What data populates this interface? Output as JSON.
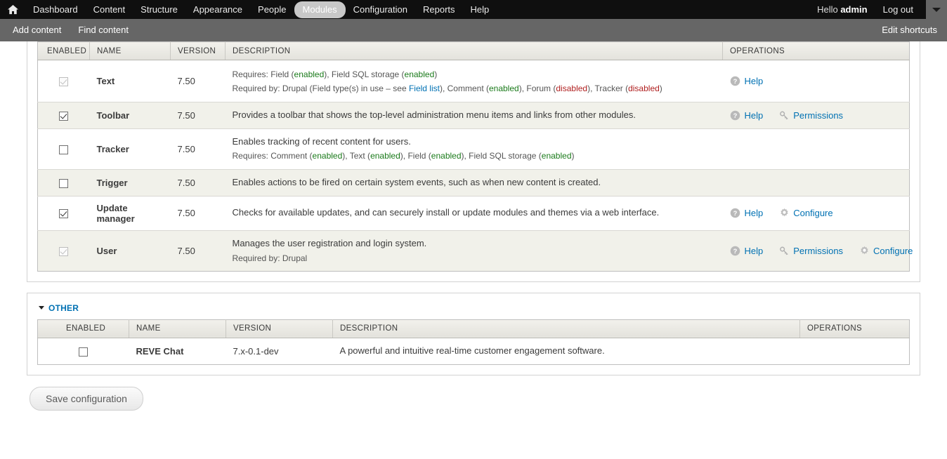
{
  "toolbar": {
    "home_icon": "home-icon",
    "items": [
      {
        "label": "Dashboard",
        "active": false
      },
      {
        "label": "Content",
        "active": false
      },
      {
        "label": "Structure",
        "active": false
      },
      {
        "label": "Appearance",
        "active": false
      },
      {
        "label": "People",
        "active": false
      },
      {
        "label": "Modules",
        "active": true
      },
      {
        "label": "Configuration",
        "active": false
      },
      {
        "label": "Reports",
        "active": false
      },
      {
        "label": "Help",
        "active": false
      }
    ],
    "greeting_prefix": "Hello ",
    "username": "admin",
    "logout_label": "Log out",
    "toggle_icon": "chevron-down-icon"
  },
  "shortcuts": {
    "items": [
      {
        "label": "Add content"
      },
      {
        "label": "Find content"
      }
    ],
    "edit_label": "Edit shortcuts"
  },
  "table_headers": {
    "enabled": "ENABLED",
    "name": "NAME",
    "version": "VERSION",
    "description": "DESCRIPTION",
    "operations": "OPERATIONS"
  },
  "core_modules": [
    {
      "name": "Text",
      "version": "7.50",
      "enabled": true,
      "locked": true,
      "desc_main": "",
      "requires_label": "Requires: ",
      "requires_parts": [
        {
          "text": "Field (",
          "style": "plain"
        },
        {
          "text": "enabled",
          "style": "enabled"
        },
        {
          "text": "), Field SQL storage (",
          "style": "plain"
        },
        {
          "text": "enabled",
          "style": "enabled"
        },
        {
          "text": ")",
          "style": "plain"
        }
      ],
      "required_by_label": "Required by: ",
      "required_by_parts": [
        {
          "text": "Drupal (Field type(s) in use – see ",
          "style": "plain"
        },
        {
          "text": "Field list",
          "style": "link"
        },
        {
          "text": "), Comment (",
          "style": "plain"
        },
        {
          "text": "enabled",
          "style": "enabled"
        },
        {
          "text": "), Forum (",
          "style": "plain"
        },
        {
          "text": "disabled",
          "style": "disabled"
        },
        {
          "text": "), Tracker (",
          "style": "plain"
        },
        {
          "text": "disabled",
          "style": "disabled"
        },
        {
          "text": ")",
          "style": "plain"
        }
      ],
      "operations": [
        {
          "label": "Help",
          "icon": "help-icon"
        }
      ]
    },
    {
      "name": "Toolbar",
      "version": "7.50",
      "enabled": true,
      "locked": false,
      "desc_main": "Provides a toolbar that shows the top-level administration menu items and links from other modules.",
      "operations": [
        {
          "label": "Help",
          "icon": "help-icon"
        },
        {
          "label": "Permissions",
          "icon": "key-icon"
        }
      ]
    },
    {
      "name": "Tracker",
      "version": "7.50",
      "enabled": false,
      "locked": false,
      "desc_main": "Enables tracking of recent content for users.",
      "requires_label": "Requires: ",
      "requires_parts": [
        {
          "text": "Comment (",
          "style": "plain"
        },
        {
          "text": "enabled",
          "style": "enabled"
        },
        {
          "text": "), Text (",
          "style": "plain"
        },
        {
          "text": "enabled",
          "style": "enabled"
        },
        {
          "text": "), Field (",
          "style": "plain"
        },
        {
          "text": "enabled",
          "style": "enabled"
        },
        {
          "text": "), Field SQL storage (",
          "style": "plain"
        },
        {
          "text": "enabled",
          "style": "enabled"
        },
        {
          "text": ")",
          "style": "plain"
        }
      ],
      "operations": []
    },
    {
      "name": "Trigger",
      "version": "7.50",
      "enabled": false,
      "locked": false,
      "desc_main": "Enables actions to be fired on certain system events, such as when new content is created.",
      "operations": []
    },
    {
      "name": "Update manager",
      "version": "7.50",
      "enabled": true,
      "locked": false,
      "desc_main": "Checks for available updates, and can securely install or update modules and themes via a web interface.",
      "operations": [
        {
          "label": "Help",
          "icon": "help-icon"
        },
        {
          "label": "Configure",
          "icon": "gear-icon"
        }
      ]
    },
    {
      "name": "User",
      "version": "7.50",
      "enabled": true,
      "locked": true,
      "desc_main": "Manages the user registration and login system.",
      "required_by_label": "Required by: ",
      "required_by_parts": [
        {
          "text": "Drupal",
          "style": "plain"
        }
      ],
      "operations": [
        {
          "label": "Help",
          "icon": "help-icon"
        },
        {
          "label": "Permissions",
          "icon": "key-icon"
        },
        {
          "label": "Configure",
          "icon": "gear-icon"
        }
      ]
    }
  ],
  "other_section": {
    "title": "OTHER",
    "collapse_icon": "triangle-down-icon",
    "modules": [
      {
        "name": "REVE Chat",
        "version": "7.x-0.1-dev",
        "enabled": false,
        "locked": false,
        "desc_main": "A powerful and intuitive real-time customer engagement software.",
        "operations": []
      }
    ]
  },
  "actions": {
    "save_label": "Save configuration"
  },
  "colors": {
    "link": "#0071b3",
    "enabled_state": "#1a7a1a",
    "disabled_state": "#b02020",
    "toolbar_bg": "#0f0f0f",
    "shortcut_bg": "#666666"
  }
}
